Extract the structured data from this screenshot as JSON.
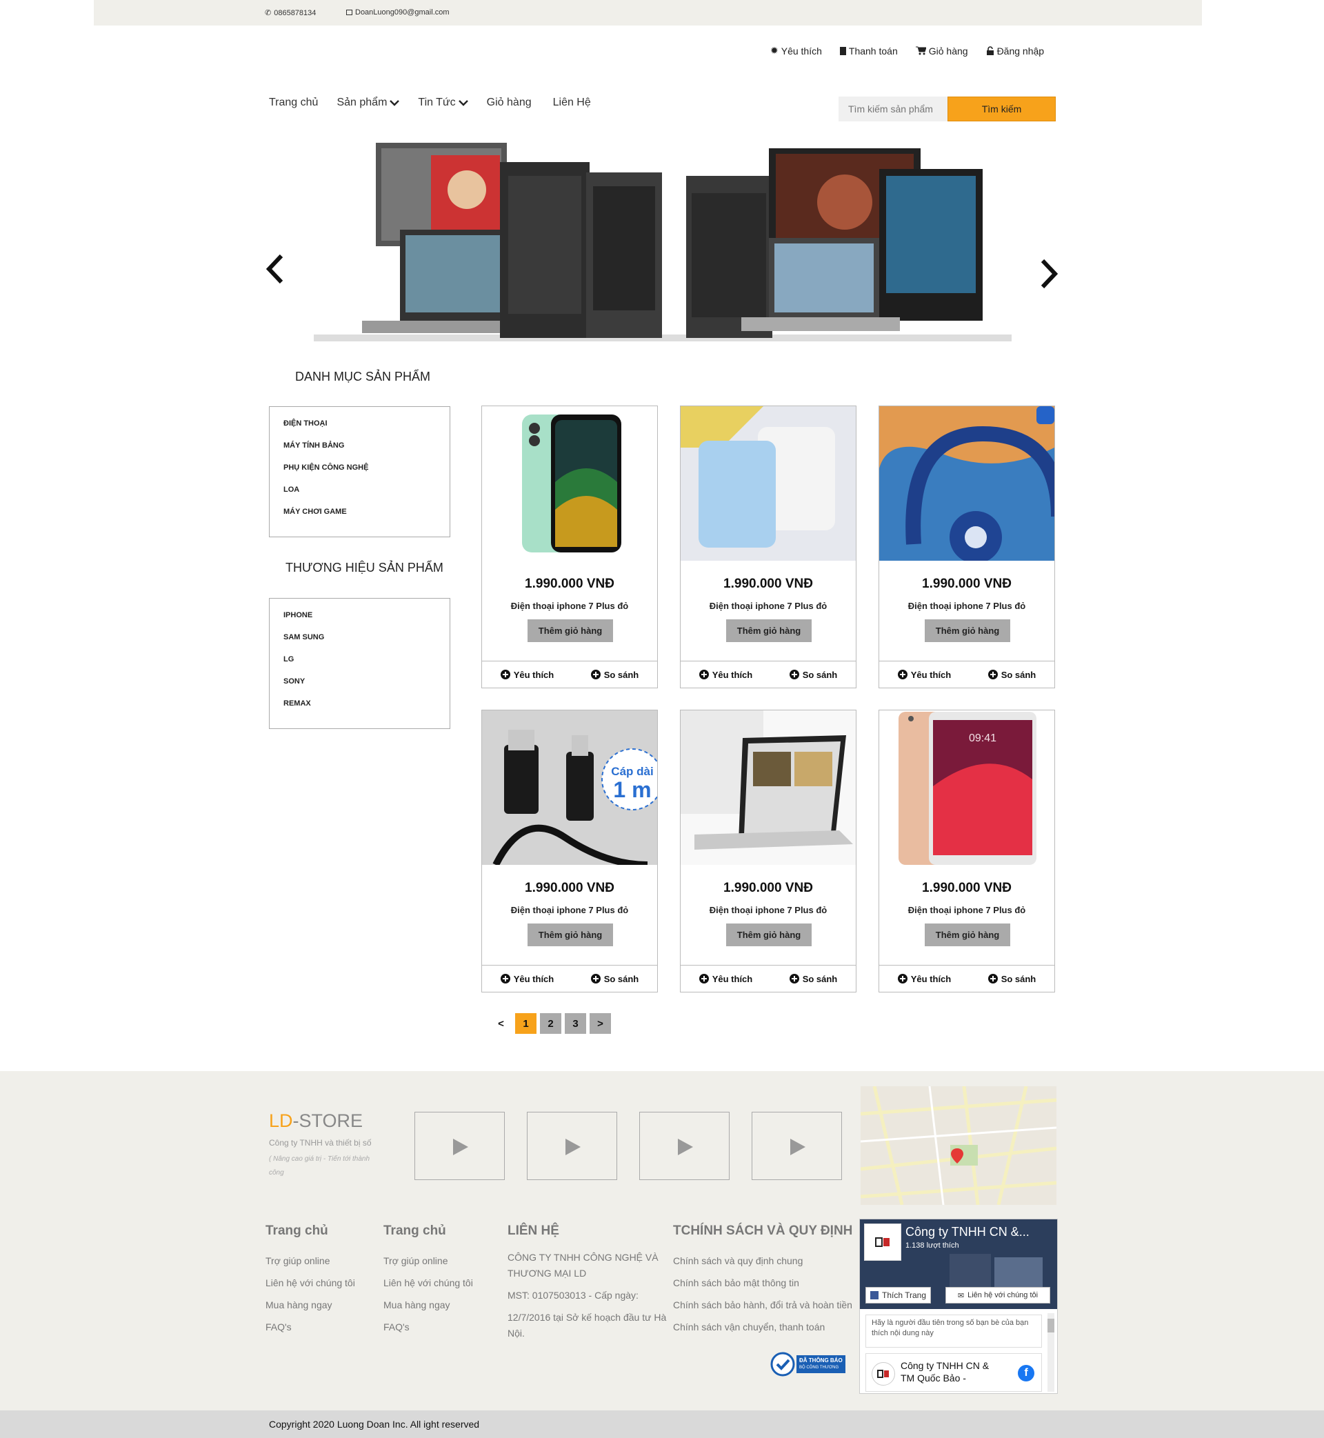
{
  "topbar": {
    "phone": "0865878134",
    "email": "DoanLuong090@gmail.com"
  },
  "usernav": [
    {
      "label": "Yêu thích",
      "icon": "gear-icon"
    },
    {
      "label": "Thanh toán",
      "icon": "document-icon"
    },
    {
      "label": "Giỏ hàng",
      "icon": "cart-icon"
    },
    {
      "label": "Đăng nhập",
      "icon": "lock-icon"
    }
  ],
  "mainnav": [
    {
      "label": "Trang chủ"
    },
    {
      "label": "Sản phẩm"
    },
    {
      "label": "Tin Tức"
    },
    {
      "label": "Giỏ hàng"
    },
    {
      "label": "Liên Hệ"
    }
  ],
  "search": {
    "placeholder": "Tìm kiếm sản phẩm",
    "button": "Tìm kiếm"
  },
  "categories": {
    "title": "DANH MỤC SẢN PHẨM",
    "items": [
      "ĐIỆN THOẠI",
      "MÁY TÍNH BẢNG",
      "PHỤ KIỆN CÔNG NGHỆ",
      "LOA",
      "MÁY CHƠI GAME"
    ]
  },
  "brands": {
    "title": "THƯƠNG HIỆU SẢN PHẨM",
    "items": [
      "IPHONE",
      "SAM SUNG",
      "LG",
      "SONY",
      "REMAX"
    ]
  },
  "products": [
    {
      "price": "1.990.000 VNĐ",
      "name": "Điện thoại iphone 7 Plus đỏ",
      "add": "Thêm giỏ hàng",
      "fav": "Yêu thích",
      "compare": "So sánh",
      "image": "phone"
    },
    {
      "price": "1.990.000 VNĐ",
      "name": "Điện thoại iphone 7 Plus đỏ",
      "add": "Thêm giỏ hàng",
      "fav": "Yêu thích",
      "compare": "So sánh",
      "image": "powerbank"
    },
    {
      "price": "1.990.000 VNĐ",
      "name": "Điện thoại iphone 7 Plus đỏ",
      "add": "Thêm giỏ hàng",
      "fav": "Yêu thích",
      "compare": "So sánh",
      "image": "headphones"
    },
    {
      "price": "1.990.000 VNĐ",
      "name": "Điện thoại iphone 7 Plus đỏ",
      "add": "Thêm giỏ hàng",
      "fav": "Yêu thích",
      "compare": "So sánh",
      "image": "cable",
      "badge_line1": "Cáp dài",
      "badge_line2": "1 m"
    },
    {
      "price": "1.990.000 VNĐ",
      "name": "Điện thoại iphone 7 Plus đỏ",
      "add": "Thêm giỏ hàng",
      "fav": "Yêu thích",
      "compare": "So sánh",
      "image": "laptop"
    },
    {
      "price": "1.990.000 VNĐ",
      "name": "Điện thoại iphone 7 Plus đỏ",
      "add": "Thêm giỏ hàng",
      "fav": "Yêu thích",
      "compare": "So sánh",
      "image": "tablet",
      "time": "09:41"
    }
  ],
  "pagination": {
    "prev": "<",
    "pages": [
      "1",
      "2",
      "3"
    ],
    "next": ">",
    "active": "1"
  },
  "footer": {
    "brand_accent": "LD",
    "brand_rest": "-STORE",
    "tagline": "Công ty TNHH và thiết bị số",
    "slogan": "( Nâng cao giá trị - Tiến tới thành công",
    "col1": {
      "title": "Trang chủ",
      "links": [
        "Trợ giúp online",
        "Liên hệ với chúng tôi",
        "Mua hàng ngay",
        "FAQ's"
      ]
    },
    "col2": {
      "title": "Trang chủ",
      "links": [
        "Trợ giúp online",
        "Liên hệ với chúng tôi",
        "Mua hàng ngay",
        "FAQ's"
      ]
    },
    "contact": {
      "title": "LIÊN HỆ",
      "lines": [
        "CÔNG TY TNHH CÔNG NGHỆ VÀ",
        "THƯƠNG MẠI LD",
        "MST: 0107503013 - Cấp ngày:",
        "12/7/2016 tại Sở kế hoạch đầu tư Hà",
        "Nội."
      ]
    },
    "policy": {
      "title": "TCHÍNH SÁCH VÀ QUY ĐỊNH",
      "links": [
        "Chính sách và quy định chung",
        "Chính sách bảo mật thông tin",
        "Chính sách bảo hành, đổi trả và hoàn tiền",
        "Chính sách vận chuyển, thanh toán"
      ]
    },
    "badge_line1": "ĐÃ THÔNG BÁO",
    "badge_line2": "BỘ CÔNG THƯƠNG",
    "fb": {
      "page_name": "Công ty TNHH CN &...",
      "likes": "1.138 lượt thích",
      "like_btn": "Thích Trang",
      "contact_btn": "Liên hệ với chúng tôi",
      "note": "Hãy là người đầu tiên trong số bạn bè của bạn thích nội dung này",
      "post_name": "Công ty TNHH CN & TM Quốc Bảo -"
    }
  },
  "copyright": "Copyright 2020 Luong Doan Inc. All ight reserved",
  "colors": {
    "accent": "#f7a21b",
    "footer_bg": "#f0efea",
    "fb_blue": "#1877f2"
  }
}
